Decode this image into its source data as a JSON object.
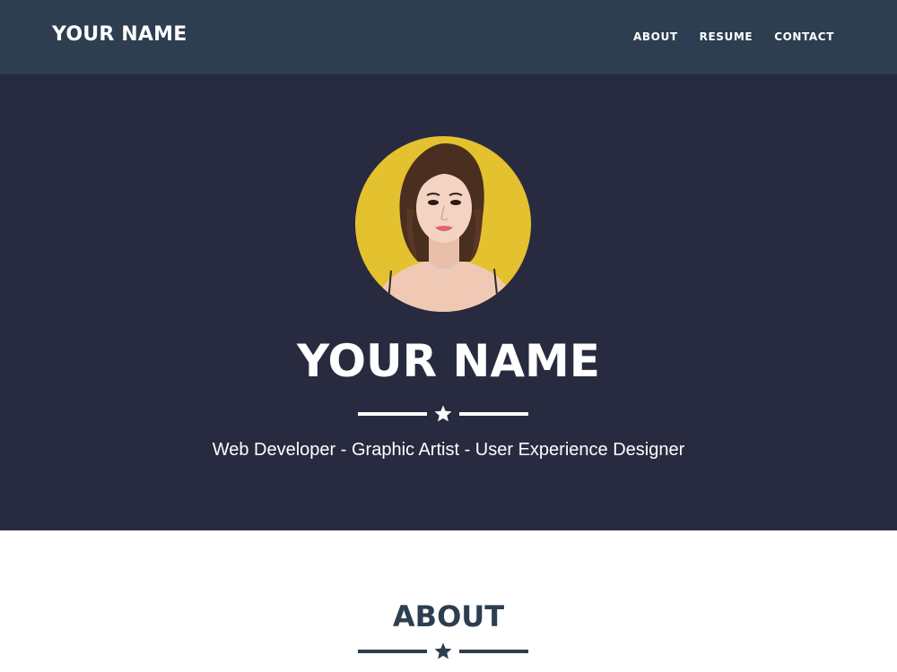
{
  "navbar": {
    "brand": "YOUR NAME",
    "links": [
      "ABOUT",
      "RESUME",
      "CONTACT"
    ],
    "background": "#2c3e50"
  },
  "hero": {
    "title": "YOUR NAME",
    "tagline": "Web Developer - Graphic Artist - User Experience Designer",
    "divider_icon": "star-icon",
    "background": "#282a40",
    "avatar_background": "#e4c12e"
  },
  "about": {
    "title": "ABOUT",
    "divider_icon": "star-icon",
    "accent": "#2c3e50"
  }
}
